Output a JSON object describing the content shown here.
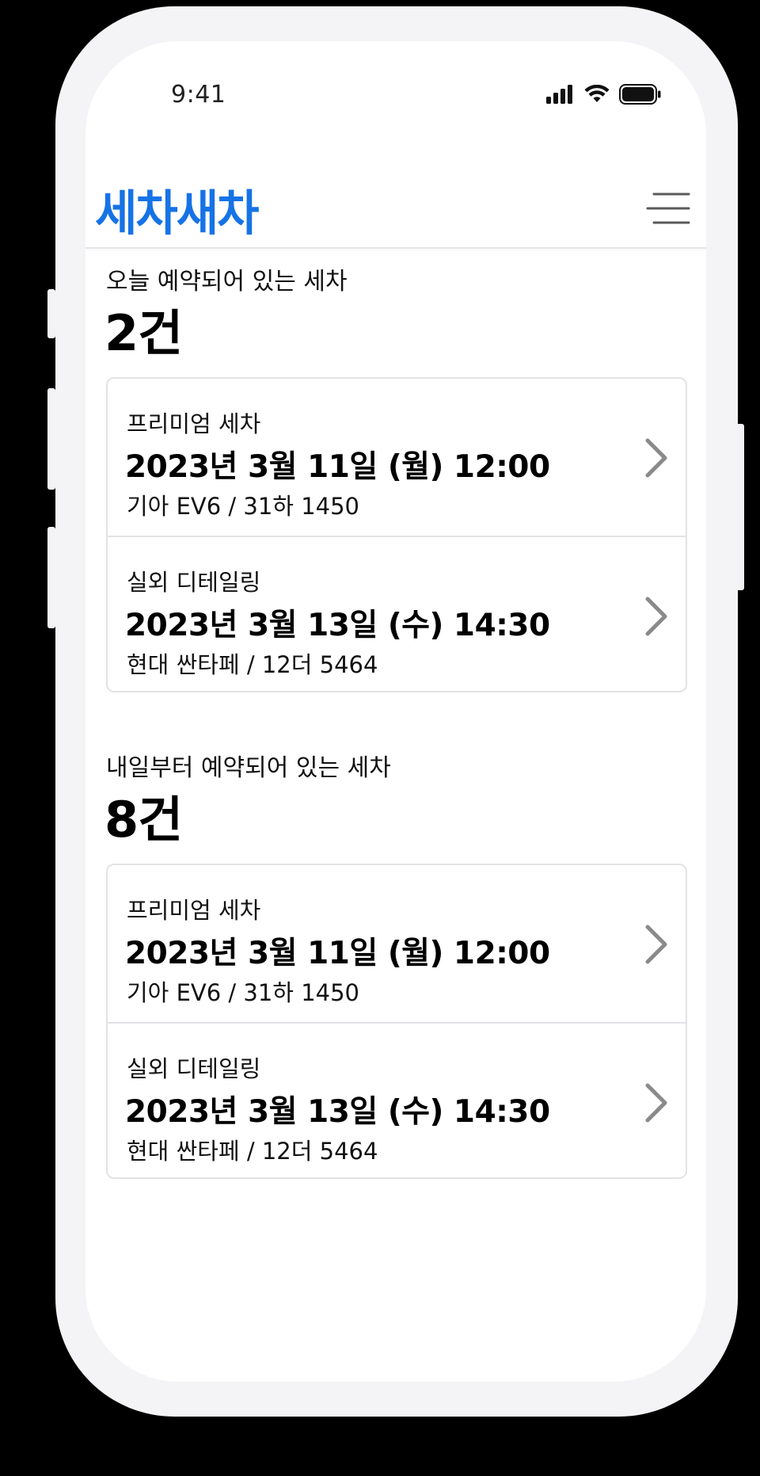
{
  "status_bar": {
    "time": "9:41"
  },
  "header": {
    "logo": "세차새차",
    "menu_icon": "hamburger-menu-icon"
  },
  "colors": {
    "brand": "#1673e6",
    "chevron": "#8a8a8a",
    "border": "#e2e3e6"
  },
  "today": {
    "label": "오늘 예약되어 있는 세차",
    "count": "2건",
    "items": [
      {
        "type": "프리미엄 세차",
        "datetime": "2023년 3월 11일 (월) 12:00",
        "car": "기아 EV6 / 31하 1450"
      },
      {
        "type": "실외 디테일링",
        "datetime": "2023년 3월 13일 (수) 14:30",
        "car": "현대 싼타페 / 12더 5464"
      }
    ]
  },
  "upcoming": {
    "label": "내일부터 예약되어 있는 세차",
    "count": "8건",
    "items": [
      {
        "type": "프리미엄 세차",
        "datetime": "2023년 3월 11일 (월) 12:00",
        "car": "기아 EV6 / 31하 1450"
      },
      {
        "type": "실외 디테일링",
        "datetime": "2023년 3월 13일 (수) 14:30",
        "car": "현대 싼타페 / 12더 5464"
      }
    ]
  }
}
